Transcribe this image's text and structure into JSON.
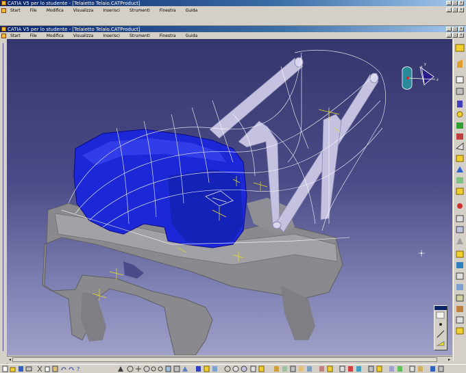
{
  "outer_window": {
    "title": "CATIA V5 per lo studente - [Telaietto Telaio.CATProduct]"
  },
  "inner_window": {
    "title": "CATIA V5 per lo studente - [Telaietto Telaio.CATProduct]"
  },
  "menu": {
    "items": [
      "Start",
      "File",
      "Modifica",
      "Visualizza",
      "Inserisci",
      "Strumenti",
      "Finestra",
      "Guida"
    ]
  },
  "colors": {
    "title_bar": "#0a246a",
    "viewport_top": "#36366e",
    "viewport_bottom": "#9fa0c8",
    "tank_blue": "#1c28d8",
    "frame_gray": "#8a8a8e",
    "tube_lavender": "#c4c2e0",
    "wireframe": "#ffffff",
    "annotation_yellow": "#e8e020"
  },
  "icons": {
    "right_toolbar": [
      "pointer-icon",
      "sketch-icon",
      "pad-icon",
      "pocket-icon",
      "shaft-icon",
      "groove-icon",
      "hole-icon",
      "rib-icon",
      "slot-icon",
      "stiffener-icon",
      "loft-icon",
      "remove-loft-icon",
      "fillet-icon",
      "chamfer-icon",
      "draft-icon",
      "shell-icon",
      "thickness-icon",
      "thread-icon",
      "split-icon",
      "thick-surface-icon",
      "close-surface-icon",
      "sew-surface-icon",
      "translate-icon",
      "rotate-icon",
      "symmetry-icon",
      "mirror-icon",
      "pattern-icon",
      "scaling-icon",
      "boolean-icon",
      "measure-icon",
      "apply-material-icon",
      "annotation-icon",
      "axis-system-icon",
      "sketcher-exit-icon"
    ],
    "bottom_toolbar": [
      "new-icon",
      "open-icon",
      "save-icon",
      "print-icon",
      "cut-icon",
      "copy-icon",
      "paste-icon",
      "undo-icon",
      "redo-icon",
      "help-icon",
      "fly-mode-icon",
      "fit-all-icon",
      "pan-icon",
      "rotate-view-icon",
      "zoom-in-icon",
      "zoom-out-icon",
      "normal-view-icon",
      "multi-view-icon",
      "iso-view-icon",
      "shading-icon",
      "hide-show-icon",
      "swap-space-icon",
      "measure-between-icon",
      "measure-item-icon",
      "measure-inertia-icon",
      "catalog-icon",
      "constraint-icon",
      "product-icon",
      "part-icon",
      "component-icon",
      "existing-component-icon",
      "replace-component-icon",
      "graph-tree-icon",
      "snap-icon",
      "explode-icon",
      "clash-icon",
      "section-icon",
      "scenes-icon",
      "annotation-icon",
      "publication-icon",
      "update-icon",
      "generate-numbering-icon",
      "bill-of-material-icon",
      "compass-icon",
      "mouse-icon"
    ]
  }
}
